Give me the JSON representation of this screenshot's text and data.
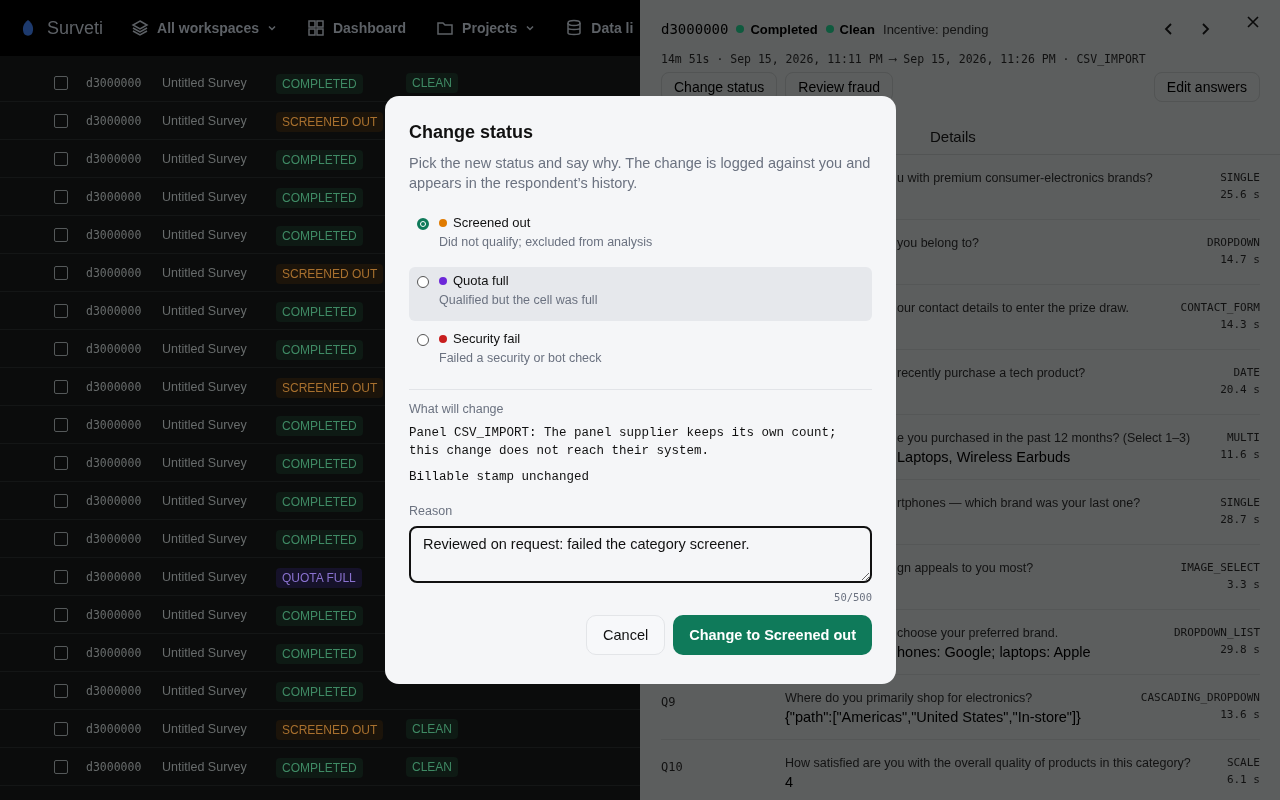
{
  "nav": {
    "logo": "Surveti",
    "workspace": "All workspaces",
    "items": [
      {
        "label": "Dashboard",
        "kind": "grid",
        "dropdown": false
      },
      {
        "label": "Projects",
        "kind": "folder",
        "dropdown": true
      },
      {
        "label": "Data li",
        "kind": "database",
        "dropdown": false
      }
    ]
  },
  "table": {
    "rows": [
      {
        "id": "d3000000",
        "survey": "Untitled Survey",
        "status": "COMPLETED",
        "kind": "completed",
        "checked": false,
        "fraud": "CLEAN"
      },
      {
        "id": "d3000000",
        "survey": "Untitled Survey",
        "status": "SCREENED OUT",
        "kind": "screened",
        "checked": false
      },
      {
        "id": "d3000000",
        "survey": "Untitled Survey",
        "status": "COMPLETED",
        "kind": "completed",
        "checked": false
      },
      {
        "id": "d3000000",
        "survey": "Untitled Survey",
        "status": "COMPLETED",
        "kind": "completed",
        "checked": false
      },
      {
        "id": "d3000000",
        "survey": "Untitled Survey",
        "status": "COMPLETED",
        "kind": "completed",
        "checked": false
      },
      {
        "id": "d3000000",
        "survey": "Untitled Survey",
        "status": "SCREENED OUT",
        "kind": "screened",
        "checked": false
      },
      {
        "id": "d3000000",
        "survey": "Untitled Survey",
        "status": "COMPLETED",
        "kind": "completed",
        "checked": false
      },
      {
        "id": "d3000000",
        "survey": "Untitled Survey",
        "status": "COMPLETED",
        "kind": "completed",
        "checked": false
      },
      {
        "id": "d3000000",
        "survey": "Untitled Survey",
        "status": "SCREENED OUT",
        "kind": "screened",
        "checked": false
      },
      {
        "id": "d3000000",
        "survey": "Untitled Survey",
        "status": "COMPLETED",
        "kind": "completed",
        "checked": false
      },
      {
        "id": "d3000000",
        "survey": "Untitled Survey",
        "status": "COMPLETED",
        "kind": "completed",
        "checked": false
      },
      {
        "id": "d3000000",
        "survey": "Untitled Survey",
        "status": "COMPLETED",
        "kind": "completed",
        "checked": false
      },
      {
        "id": "d3000000",
        "survey": "Untitled Survey",
        "status": "COMPLETED",
        "kind": "completed",
        "checked": false
      },
      {
        "id": "d3000000",
        "survey": "Untitled Survey",
        "status": "QUOTA FULL",
        "kind": "quota",
        "checked": false
      },
      {
        "id": "d3000000",
        "survey": "Untitled Survey",
        "status": "COMPLETED",
        "kind": "completed",
        "checked": false
      },
      {
        "id": "d3000000",
        "survey": "Untitled Survey",
        "status": "COMPLETED",
        "kind": "completed",
        "checked": false
      },
      {
        "id": "d3000000",
        "survey": "Untitled Survey",
        "status": "COMPLETED",
        "kind": "completed",
        "checked": false
      },
      {
        "id": "d3000000",
        "survey": "Untitled Survey",
        "status": "SCREENED OUT",
        "kind": "screened",
        "checked": false,
        "fraud": "CLEAN"
      },
      {
        "id": "d3000000",
        "survey": "Untitled Survey",
        "status": "COMPLETED",
        "kind": "completed",
        "checked": false,
        "fraud": "CLEAN"
      }
    ]
  },
  "drawer": {
    "id": "d3000000",
    "badges": [
      {
        "label": "Completed",
        "color": "#0f5a3e"
      },
      {
        "label": "Clean",
        "color": "#0f5a3e"
      }
    ],
    "incentive": "Incentive: pending",
    "meta": "14m 51s · Sep 15, 2026, 11:11 PM ⟶ Sep 15, 2026, 11:26 PM · CSV_IMPORT",
    "actions": [
      "Change status",
      "Review fraud"
    ],
    "edit_button": "Edit answers",
    "tabs": [
      {
        "label": "Details",
        "selected": false
      }
    ],
    "answers": [
      {
        "kind": "partial",
        "question": "u with premium consumer-electronics brands?",
        "type": "SINGLE",
        "time": "25.6 s"
      },
      {
        "kind": "partial",
        "question": "you belong to?",
        "type": "DROPDOWN",
        "time": "14.7 s"
      },
      {
        "kind": "partial",
        "question": "our contact details to enter the prize draw.",
        "type": "CONTACT_FORM",
        "time": "14.3 s"
      },
      {
        "kind": "partial",
        "question": "recently purchase a tech product?",
        "type": "DATE",
        "time": "20.4 s"
      },
      {
        "kind": "partial",
        "question": "e you purchased in the past 12 months? (Select 1–3)",
        "answer": "Laptops, Wireless Earbuds",
        "type": "MULTI",
        "time": "11.6 s"
      },
      {
        "kind": "partial",
        "question": "rtphones — which brand was your last one?",
        "type": "SINGLE",
        "time": "28.7 s"
      },
      {
        "kind": "partial",
        "question": "gn appeals to you most?",
        "type": "IMAGE_SELECT",
        "time": "3.3 s"
      },
      {
        "kind": "partial",
        "question": "choose your preferred brand.",
        "answer": "hones: Google; laptops: Apple",
        "type": "DROPDOWN_LIST",
        "time": "29.8 s"
      },
      {
        "kind": "full",
        "qid": "Q9",
        "question": "Where do you primarily shop for electronics?",
        "answer": "{\"path\":[\"Americas\",\"United States\",\"In-store\"]}",
        "type": "CASCADING_DROPDOWN",
        "time": "13.6 s"
      },
      {
        "kind": "full",
        "qid": "Q10",
        "question": "How satisfied are you with the overall quality of products in this category?",
        "answer": "4",
        "type": "SCALE",
        "time": "6.1 s"
      }
    ]
  },
  "modal": {
    "title": "Change status",
    "description": "Pick the new status and say why. The change is logged against you and appears in the respondent’s history.",
    "options": [
      {
        "label": "Screened out",
        "hint": "Did not qualify; excluded from analysis",
        "color": "#e07b00",
        "selected": true,
        "hovered": false
      },
      {
        "label": "Quota full",
        "hint": "Qualified but the cell was full",
        "color": "#6d28d9",
        "selected": false,
        "hovered": true
      },
      {
        "label": "Security fail",
        "hint": "Failed a security or bot check",
        "color": "#c81e1e",
        "selected": false,
        "hovered": false
      }
    ],
    "impact_label": "What will change",
    "impact_lines": [
      "Panel CSV_IMPORT: The panel supplier keeps its own count; this change does not reach their system.",
      "Billable stamp unchanged"
    ],
    "reason_label": "Reason",
    "reason": "Reviewed on request: failed the category screener.",
    "counter": "50/500",
    "cancel": "Cancel",
    "confirm": "Change to Screened out"
  }
}
